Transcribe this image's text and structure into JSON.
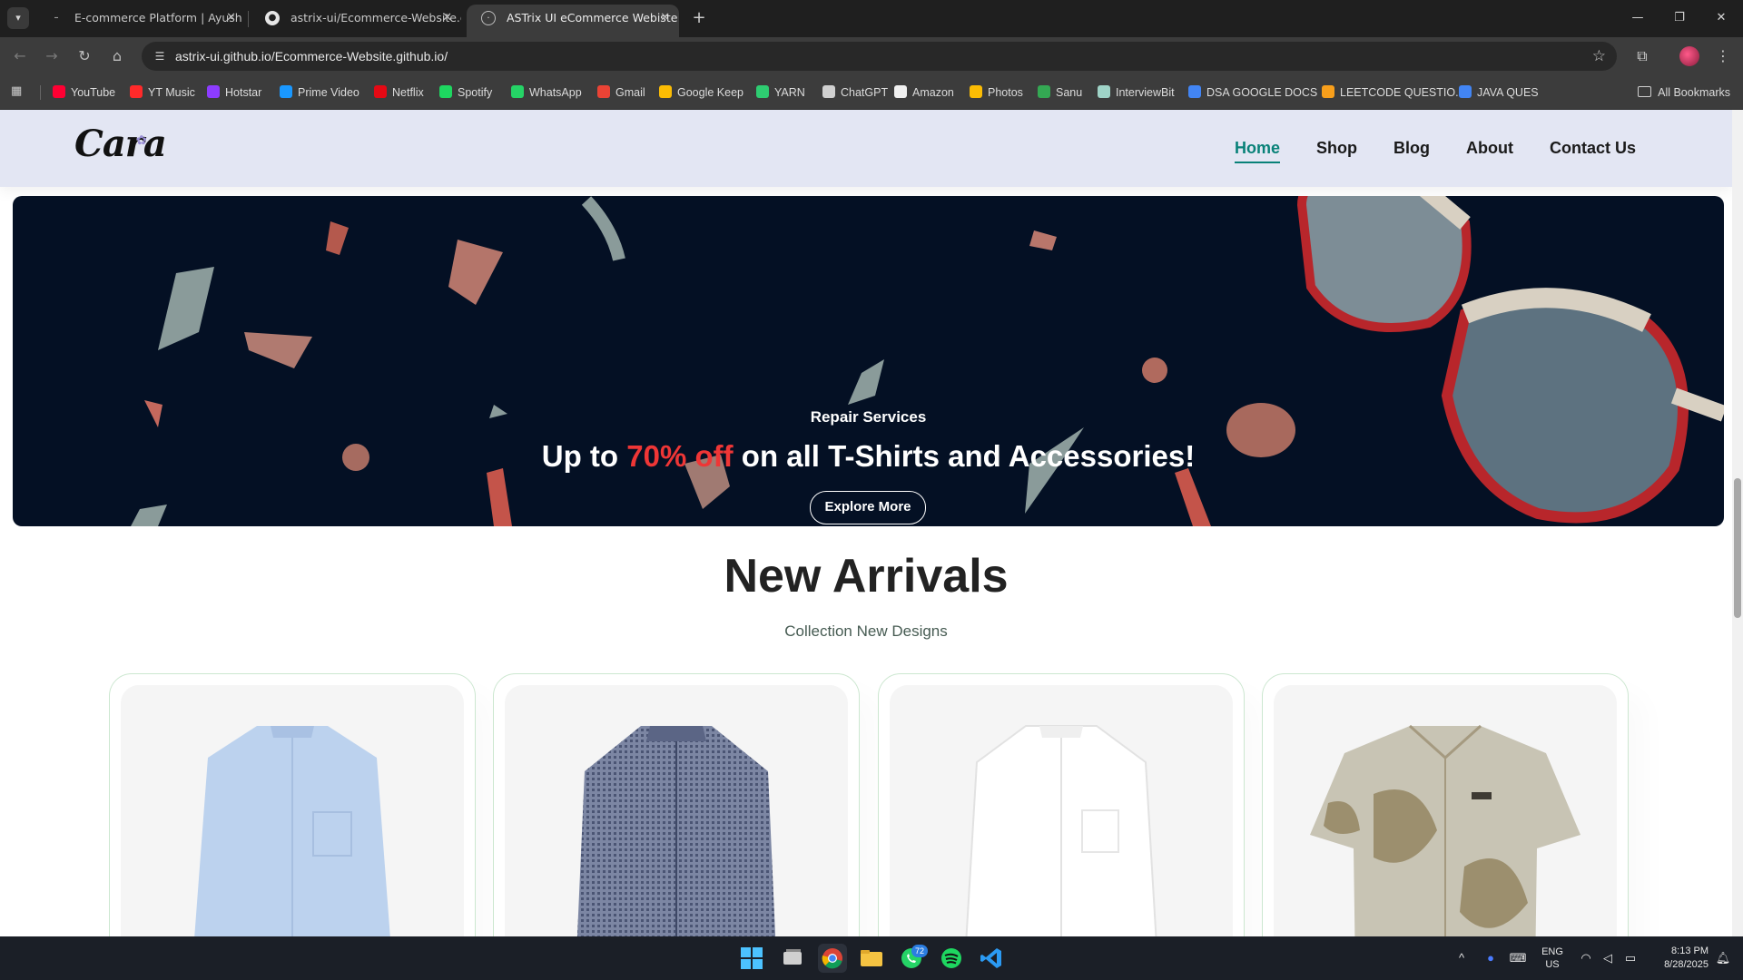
{
  "browser": {
    "tabs": [
      {
        "title": "E-commerce Platform | Ayush S",
        "icon": "page-icon"
      },
      {
        "title": "astrix-ui/Ecommerce-Website.g",
        "icon": "github-icon"
      },
      {
        "title": "ASTrix UI eCommerce Webiste",
        "icon": "globe-icon"
      }
    ],
    "url": "astrix-ui.github.io/Ecommerce-Website.github.io/",
    "bookmarks": [
      {
        "label": "YouTube",
        "color": "#ff0033"
      },
      {
        "label": "YT Music",
        "color": "#ff2a2a"
      },
      {
        "label": "Hotstar",
        "color": "#8d3cff"
      },
      {
        "label": "Prime Video",
        "color": "#1a98ff"
      },
      {
        "label": "Netflix",
        "color": "#e50914"
      },
      {
        "label": "Spotify",
        "color": "#1ed760"
      },
      {
        "label": "WhatsApp",
        "color": "#25d366"
      },
      {
        "label": "Gmail",
        "color": "#ea4335"
      },
      {
        "label": "Google Keep",
        "color": "#fbbc04"
      },
      {
        "label": "YARN",
        "color": "#2ecc71"
      },
      {
        "label": "ChatGPT",
        "color": "#d0d0d0"
      },
      {
        "label": "Amazon",
        "color": "#f0f0f0"
      },
      {
        "label": "Photos",
        "color": "#fbbc04"
      },
      {
        "label": "Sanu",
        "color": "#34a853"
      },
      {
        "label": "InterviewBit",
        "color": "#9fd3c7"
      },
      {
        "label": "DSA GOOGLE DOCS",
        "color": "#4285f4"
      },
      {
        "label": "LEETCODE QUESTIO...",
        "color": "#f89f1b"
      },
      {
        "label": "JAVA QUES",
        "color": "#4285f4"
      }
    ],
    "all_bookmarks_label": "All Bookmarks"
  },
  "site": {
    "logo": "Cara",
    "nav": [
      {
        "label": "Home",
        "active": true
      },
      {
        "label": "Shop"
      },
      {
        "label": "Blog"
      },
      {
        "label": "About"
      },
      {
        "label": "Contact Us"
      }
    ],
    "accent_color": "#088178"
  },
  "banner": {
    "subtitle": "Repair Services",
    "headline_pre": "Up to",
    "headline_highlight": "70% off",
    "headline_post": "on all T-Shirts and Accessories!",
    "button_label": "Explore More",
    "highlight_color": "#ef3636"
  },
  "new_arrivals": {
    "title": "New Arrivals",
    "subtitle": "Collection New Designs",
    "products": [
      {
        "name": "light-blue-band-collar-shirt",
        "color": "#bcd2ee"
      },
      {
        "name": "navy-gingham-shirt",
        "color": "#5b6585"
      },
      {
        "name": "white-band-collar-shirt",
        "color": "#efefef"
      },
      {
        "name": "printed-short-sleeve-shirt",
        "color": "#c8c4b4"
      }
    ]
  },
  "taskbar": {
    "whatsapp_badge": "72",
    "lang_line1": "ENG",
    "lang_line2": "US",
    "time": "8:13 PM",
    "date": "8/28/2025"
  }
}
